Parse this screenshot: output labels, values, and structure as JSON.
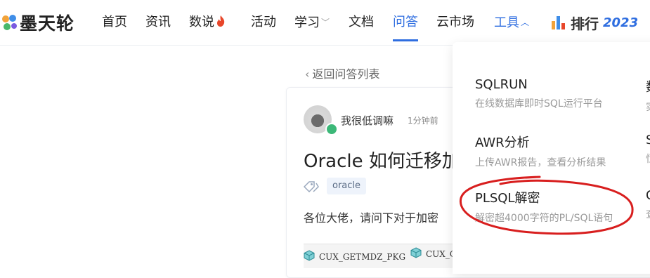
{
  "logo": {
    "text": "墨天轮"
  },
  "nav": {
    "items": [
      {
        "label": "首页"
      },
      {
        "label": "资讯"
      },
      {
        "label": "数说"
      },
      {
        "label": "活动"
      },
      {
        "label": "学习"
      },
      {
        "label": "文档"
      },
      {
        "label": "问答"
      },
      {
        "label": "云市场"
      },
      {
        "label": "工具"
      }
    ],
    "active": "问答",
    "rank_label": "排行",
    "rank_year": "2023"
  },
  "back_link": "返回问答列表",
  "question": {
    "author": "我很低调嘛",
    "time": "1分钟前",
    "title": "Oracle 如何迁移加",
    "tag": "oracle",
    "body": "各位大佬，请问下对于加密",
    "pkg_tabs": [
      "CUX_GETMDZ_PKG",
      "CUX_GETMDZ_PKG"
    ]
  },
  "tools_menu": {
    "items": [
      {
        "title": "SQLRUN",
        "desc": "在线数据库即时SQL运行平台"
      },
      {
        "title": "AWR分析",
        "desc": "上传AWR报告，查看分析结果"
      },
      {
        "title": "PLSQL解密",
        "desc": "解密超4000字符的PL/SQL语句"
      }
    ],
    "col2_partial": [
      {
        "title": "数",
        "desc": "实"
      },
      {
        "title": "S",
        "desc": "恒"
      },
      {
        "title": "C",
        "desc": "查"
      }
    ]
  },
  "colors": {
    "accent": "#2f6ee0",
    "annotation": "#d81e1e",
    "hot": "#e8462a"
  },
  "icons": [
    "logo-icon",
    "fire-icon",
    "chevron-down-icon",
    "chevron-up-icon",
    "bar-chart-icon",
    "chevron-left-icon",
    "tag-icon",
    "package-icon"
  ]
}
